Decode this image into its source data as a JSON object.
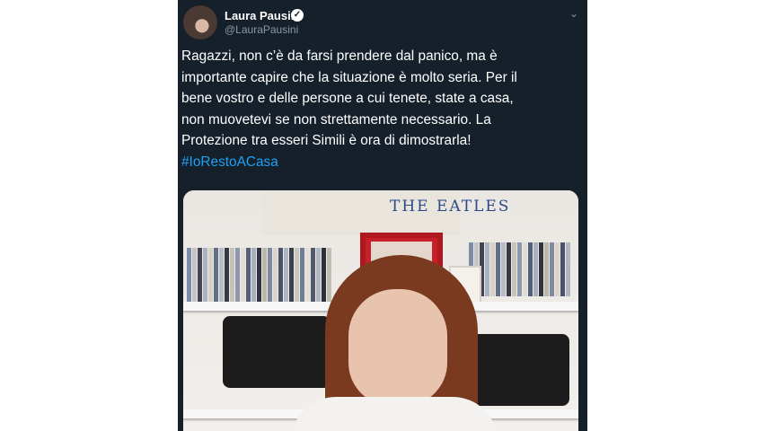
{
  "tweet": {
    "display_name": "Laura Pausini",
    "handle": "@LauraPausini",
    "text": "Ragazzi, non c’è da farsi prendere dal panico, ma è\nimportante capire che la situazione è molto seria. Per il\nbene vostro e delle persone a cui tenete, state a casa,\nnon muovetevi se non strettamente necessario. La\nProtezione tra esseri Simili è ora di dimostrarla!",
    "hashtag": "#IoRestoACasa",
    "poster_text": "THE   EATLES",
    "icons": [
      "verified-badge-icon",
      "chevron-down-icon"
    ]
  },
  "colors": {
    "background": "#15202b",
    "text": "#ffffff",
    "secondary_text": "#8899a6",
    "link": "#1da1f2"
  }
}
